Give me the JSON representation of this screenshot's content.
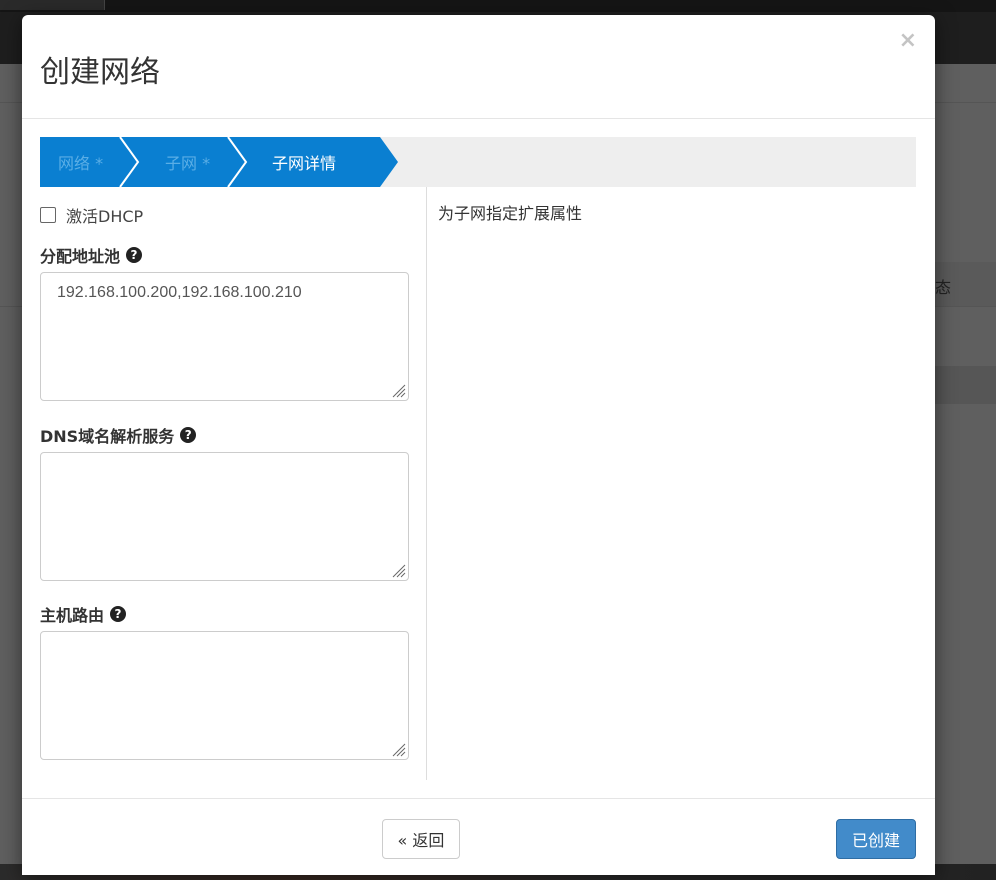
{
  "modal": {
    "title": "创建网络",
    "close_symbol": "×"
  },
  "wizard": {
    "steps": [
      {
        "label": "网络 *",
        "state": "done"
      },
      {
        "label": "子网 *",
        "state": "done"
      },
      {
        "label": "子网详情",
        "state": "active"
      }
    ],
    "colors": {
      "step_bg": "#0a7fd1",
      "done_text": "#5aaee6",
      "active_text": "#ffffff",
      "track": "#eeeeee"
    }
  },
  "form": {
    "dhcp_label": "激活DHCP",
    "dhcp_checked": false,
    "pool_label": "分配地址池",
    "pool_value": "192.168.100.200,192.168.100.210",
    "dns_label": "DNS域名解析服务",
    "dns_value": "",
    "routes_label": "主机路由",
    "routes_value": "",
    "help_icon": "question-circle-icon"
  },
  "description": "为子网指定扩展属性",
  "footer": {
    "back_label": "« 返回",
    "create_label": "已创建",
    "create_color": "#428bca"
  },
  "background": {
    "partial_text": "态"
  }
}
